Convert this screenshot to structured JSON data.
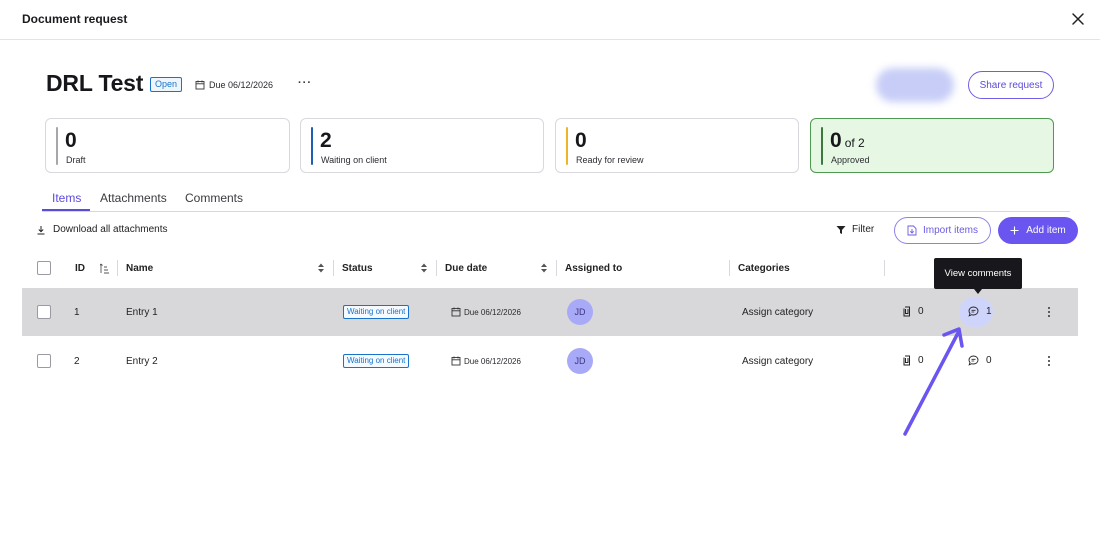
{
  "window": {
    "title": "Document request"
  },
  "request": {
    "name": "DRL Test",
    "status_badge": "Open",
    "due": "Due 06/12/2026",
    "more": "···",
    "share_label": "Share request"
  },
  "summary": [
    {
      "count": "0",
      "of": "",
      "label": "Draft",
      "color": "#a6a6ab"
    },
    {
      "count": "2",
      "of": "",
      "label": "Waiting on client",
      "color": "#1e5fb3"
    },
    {
      "count": "0",
      "of": "",
      "label": "Ready for review",
      "color": "#f0b429"
    },
    {
      "count": "0",
      "of": "of 2",
      "label": "Approved",
      "color": "#3b7a3c"
    }
  ],
  "tabs": [
    "Items",
    "Attachments",
    "Comments"
  ],
  "active_tab": "Items",
  "toolbar": {
    "download_all": "Download all attachments",
    "filter": "Filter",
    "import": "Import items",
    "add": "Add item"
  },
  "table": {
    "headers": [
      "ID",
      "Name",
      "Status",
      "Due date",
      "Assigned to",
      "Categories"
    ],
    "rows": [
      {
        "id": "1",
        "name": "Entry 1",
        "status": "Waiting on client",
        "due": "Due 06/12/2026",
        "assignee": "JD",
        "category": "Assign category",
        "attachments": "0",
        "comments": "1"
      },
      {
        "id": "2",
        "name": "Entry 2",
        "status": "Waiting on client",
        "due": "Due 06/12/2026",
        "assignee": "JD",
        "category": "Assign category",
        "attachments": "0",
        "comments": "0"
      }
    ]
  },
  "tooltip": "View comments",
  "colors": {
    "accent": "#6a55f0",
    "status_blue": "#1a73c9",
    "approved_bg": "#e6f8e4",
    "annotation_arrow": "#6a55f0"
  }
}
